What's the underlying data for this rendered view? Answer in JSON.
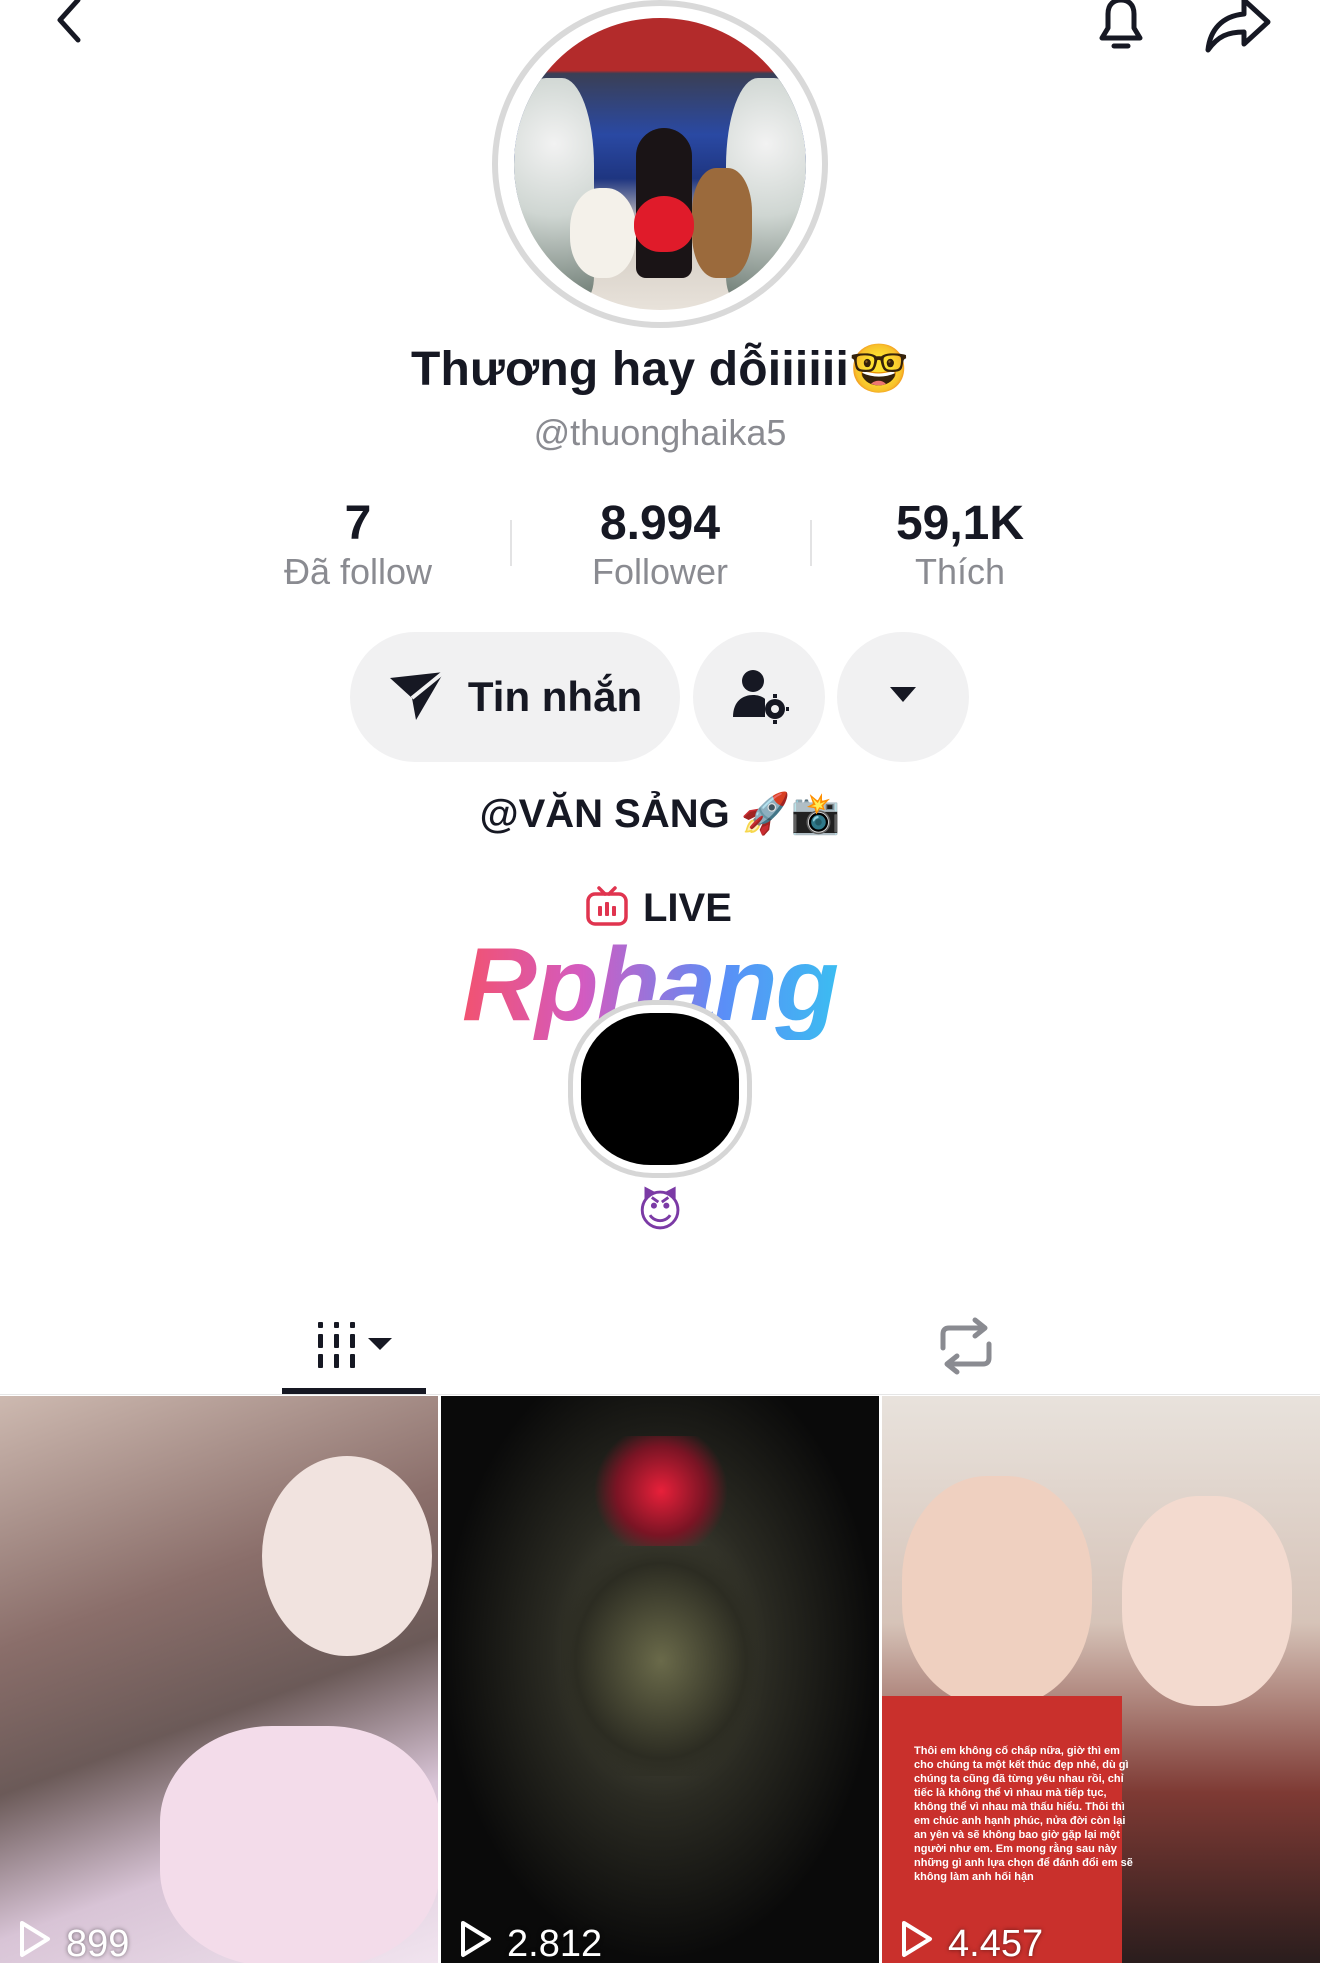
{
  "profile": {
    "display_name": "Thương hay dỗiiiiii",
    "display_name_emoji": "🤓",
    "username": "@thuonghaika5",
    "bio_link": "@VĂN SẢNG 🚀📸"
  },
  "stats": [
    {
      "value": "7",
      "label": "Đã follow"
    },
    {
      "value": "8.994",
      "label": "Follower"
    },
    {
      "value": "59,1K",
      "label": "Thích"
    }
  ],
  "actions": {
    "message_label": "Tin nhắn"
  },
  "live": {
    "label": "LIVE",
    "story_emoji": "😈"
  },
  "watermark": "Rphang",
  "videos": [
    {
      "views": "899"
    },
    {
      "views": "2.812"
    },
    {
      "views": "4.457"
    }
  ],
  "tile3_caption": "Thôi em không cố chấp nữa, giờ thì em cho chúng ta một kết thúc đẹp nhé, dù gì chúng ta cũng đã từng yêu nhau rồi, chỉ tiếc là không thể vì nhau mà tiếp tục, không thể vì nhau mà thấu hiểu. Thôi thì em chúc anh hạnh phúc, nửa đời còn lại an yên và sẽ không bao giờ gặp lại một người như em. Em mong rằng sau này những gì anh lựa chọn để đánh đổi em sẽ không làm anh hối hận",
  "icons": {
    "back": "chevron-left-icon",
    "bell": "bell-icon",
    "share": "share-arrow-icon",
    "message": "paper-plane-icon",
    "friend": "user-settings-icon",
    "more": "caret-down-icon",
    "live": "tv-icon",
    "videos_tab": "grid-bars-icon",
    "reposts_tab": "repost-icon",
    "play": "play-outline-icon"
  },
  "colors": {
    "text": "#161823",
    "muted": "#8a8b91",
    "button_bg": "#f1f1f2",
    "live_red": "#fe2c55"
  }
}
